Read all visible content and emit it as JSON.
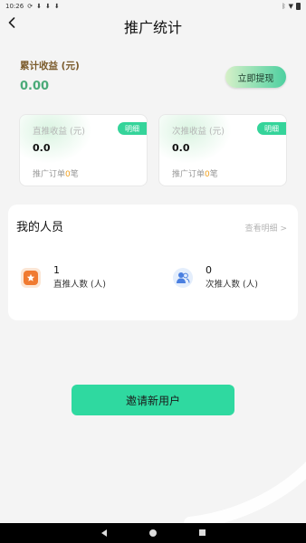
{
  "status_bar": {
    "time": "10:26"
  },
  "nav": {
    "title": "推广统计"
  },
  "earnings": {
    "label": "累计收益 (元)",
    "value": "0.00",
    "withdraw_label": "立即提现"
  },
  "cards": [
    {
      "title": "直推收益 (元)",
      "value": "0.0",
      "orders_prefix": "推广订单",
      "orders_count": "0",
      "orders_suffix": "笔",
      "badge": "明细"
    },
    {
      "title": "次推收益 (元)",
      "value": "0.0",
      "orders_prefix": "推广订单",
      "orders_count": "0",
      "orders_suffix": "笔",
      "badge": "明细"
    }
  ],
  "people": {
    "title": "我的人员",
    "view_detail": "查看明细 >",
    "stats": [
      {
        "count": "1",
        "label": "直推人数 (人)",
        "icon": "star-badge-icon"
      },
      {
        "count": "0",
        "label": "次推人数 (人)",
        "icon": "people-icon"
      }
    ]
  },
  "invite": {
    "label": "邀请新用户"
  },
  "colors": {
    "accent": "#2fd9a0",
    "earn_value": "#4aaa78",
    "orders_count": "#f0a020",
    "star_icon": "#f07a30"
  }
}
